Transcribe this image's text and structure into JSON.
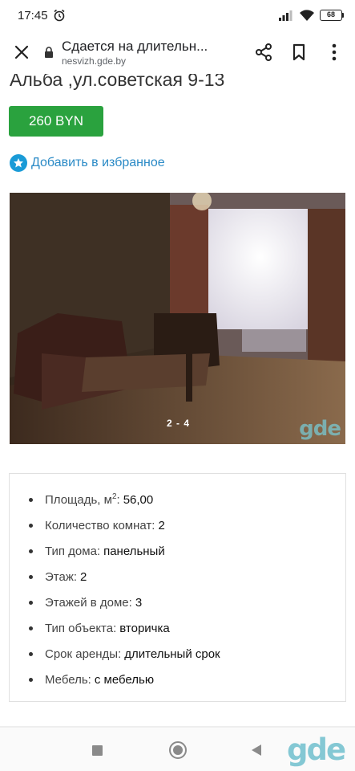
{
  "status_bar": {
    "time": "17:45",
    "battery": "68",
    "icons": [
      "alarm-icon",
      "signal-icon",
      "wifi-icon",
      "battery-icon"
    ]
  },
  "browser": {
    "page_title": "Сдается на длительн...",
    "url": "nesvizh.gde.by",
    "icons": [
      "close-icon",
      "lock-icon",
      "share-icon",
      "bookmark-icon",
      "more-vertical-icon"
    ]
  },
  "listing": {
    "title": "Альба ,ул.советская 9-13",
    "price": "260 BYN",
    "favorite_label": "Добавить в избранное",
    "photo": {
      "counter": "2 - 4",
      "watermark": "gde"
    },
    "details": [
      {
        "label": "Площадь, м",
        "sup": "2",
        "suffix": ":",
        "value": "56,00"
      },
      {
        "label": "Количество комнат:",
        "value": "2"
      },
      {
        "label": "Тип дома:",
        "value": "панельный"
      },
      {
        "label": "Этаж:",
        "value": "2"
      },
      {
        "label": "Этажей в доме:",
        "value": "3"
      },
      {
        "label": "Тип объекта:",
        "value": "вторичка"
      },
      {
        "label": "Срок аренды:",
        "value": "длительный срок"
      },
      {
        "label": "Мебель:",
        "value": "с мебелью"
      }
    ]
  },
  "nav_bar": {
    "icons": [
      "recents-square-icon",
      "home-circle-icon",
      "back-triangle-icon"
    ],
    "logo": "gde"
  },
  "colors": {
    "price_green": "#2aa23e",
    "link_blue": "#2a8ac6",
    "star_blue": "#1a9bd7"
  }
}
